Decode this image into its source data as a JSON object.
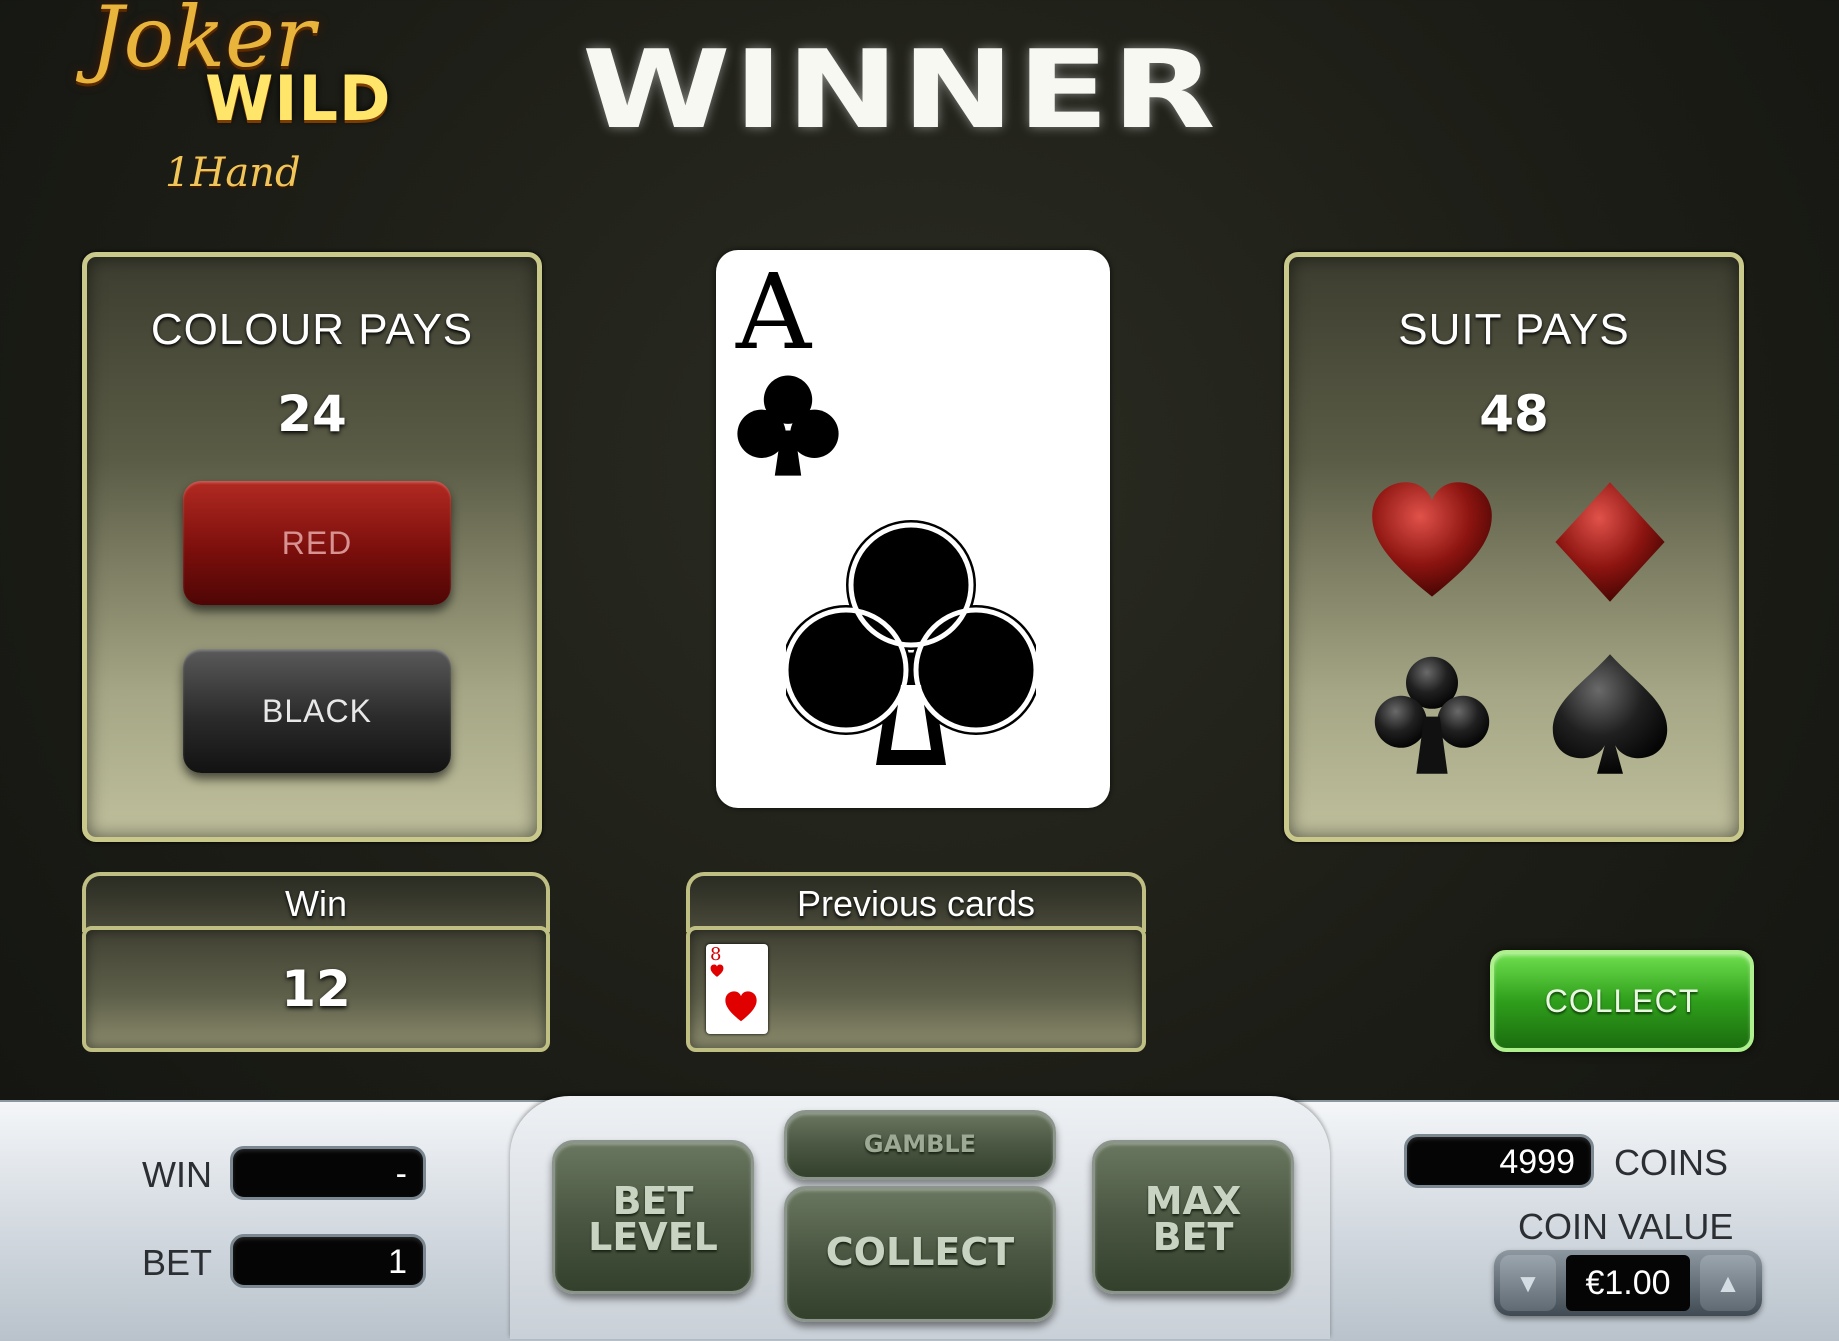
{
  "logo": {
    "joker": "Joker",
    "wild": "WILD",
    "hand": "1Hand"
  },
  "banner": "WINNER",
  "colour_panel": {
    "title": "COLOUR PAYS",
    "value": "24",
    "red_label": "RED",
    "black_label": "BLACK"
  },
  "suit_panel": {
    "title": "SUIT PAYS",
    "value": "48",
    "suits": [
      "heart-icon",
      "diamond-icon",
      "club-icon",
      "spade-icon"
    ]
  },
  "current_card": {
    "rank": "A",
    "suit": "club-icon"
  },
  "win_box": {
    "label": "Win",
    "value": "12"
  },
  "previous_cards": {
    "label": "Previous cards",
    "cards": [
      {
        "rank": "8",
        "suit": "heart-icon"
      }
    ]
  },
  "collect_button": "COLLECT",
  "controls": {
    "win_label": "WIN",
    "win_value": "-",
    "bet_label": "BET",
    "bet_value": "1",
    "bet_level_line1": "BET",
    "bet_level_line2": "LEVEL",
    "gamble": "GAMBLE",
    "collect": "COLLECT",
    "max_bet_line1": "MAX",
    "max_bet_line2": "BET",
    "coins_value": "4999",
    "coins_label": "COINS",
    "coin_value_label": "COIN VALUE",
    "coin_value": "€1.00"
  },
  "colors": {
    "red": "#7c0f0c",
    "green": "#2f9f1c",
    "olive": "#4b5742"
  }
}
